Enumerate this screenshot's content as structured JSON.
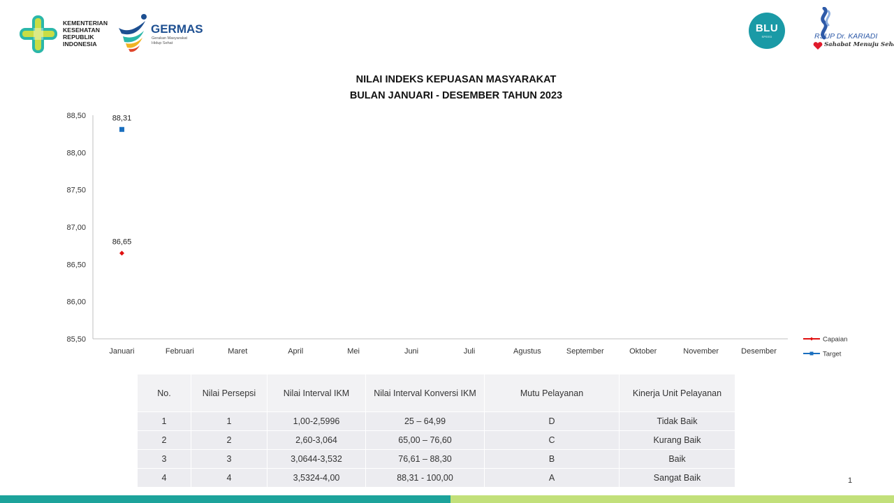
{
  "header": {
    "kemenkes_text": "KEMENTERIAN\nKESEHATAN\nREPUBLIK\nINDONESIA",
    "germas_title": "GERMAS",
    "germas_subtitle": "Gerakan Masyarakat\nHidup Sehat",
    "blu_text": "BLU",
    "blu_sub": "SPEED",
    "rsup_text": "RSUP Dr. KARIADI",
    "rsup_tagline": "Sahabat Menuju Sehat"
  },
  "chart_data": {
    "type": "line",
    "title_line1": "NILAI INDEKS KEPUASAN MASYARAKAT",
    "title_line2": "BULAN JANUARI - DESEMBER TAHUN 2023",
    "categories": [
      "Januari",
      "Februari",
      "Maret",
      "April",
      "Mei",
      "Juni",
      "Juli",
      "Agustus",
      "September",
      "Oktober",
      "November",
      "Desember"
    ],
    "ylim": [
      85.5,
      88.5
    ],
    "yticks": [
      85.5,
      86.0,
      86.5,
      87.0,
      87.5,
      88.0,
      88.5
    ],
    "ytick_labels": [
      "85,50",
      "86,00",
      "86,50",
      "87,00",
      "87,50",
      "88,00",
      "88,50"
    ],
    "grid": false,
    "legend_position": "right",
    "series": [
      {
        "name": "Capaian",
        "color": "#e01010",
        "marker": "diamond",
        "values": [
          86.65,
          null,
          null,
          null,
          null,
          null,
          null,
          null,
          null,
          null,
          null,
          null
        ],
        "labels": [
          "86,65",
          "",
          "",
          "",
          "",
          "",
          "",
          "",
          "",
          "",
          "",
          ""
        ]
      },
      {
        "name": "Target",
        "color": "#1a6fbf",
        "marker": "square",
        "values": [
          88.31,
          null,
          null,
          null,
          null,
          null,
          null,
          null,
          null,
          null,
          null,
          null
        ],
        "labels": [
          "88,31",
          "",
          "",
          "",
          "",
          "",
          "",
          "",
          "",
          "",
          "",
          ""
        ]
      }
    ]
  },
  "table": {
    "headers": [
      "No.",
      "Nilai Persepsi",
      "Nilai Interval IKM",
      "Nilai Interval Konversi IKM",
      "Mutu Pelayanan",
      "Kinerja Unit Pelayanan"
    ],
    "rows": [
      [
        "1",
        "1",
        "1,00-2,5996",
        "25 – 64,99",
        "D",
        "Tidak Baik"
      ],
      [
        "2",
        "2",
        "2,60-3,064",
        "65,00 – 76,60",
        "C",
        "Kurang Baik"
      ],
      [
        "3",
        "3",
        "3,0644-3,532",
        "76,61 – 88,30",
        "B",
        "Baik"
      ],
      [
        "4",
        "4",
        "3,5324-4,00",
        "88,31 - 100,00",
        "A",
        "Sangat Baik"
      ]
    ]
  },
  "page_number": "1",
  "colors": {
    "teal": "#1ca39b",
    "lime": "#c2e07a"
  }
}
